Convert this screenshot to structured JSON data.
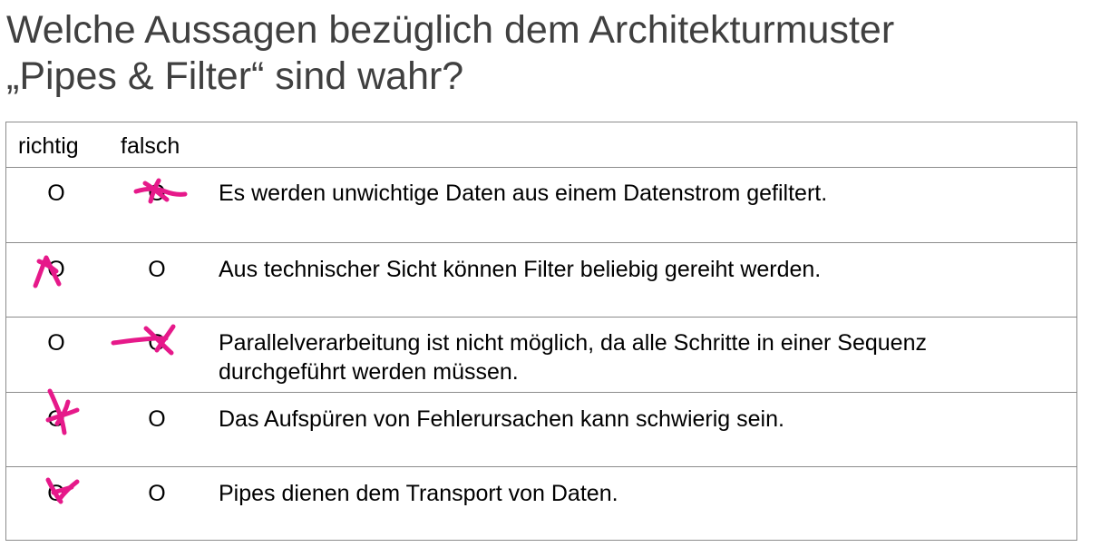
{
  "title": {
    "line1": "Welche Aussagen bezüglich dem Architekturmuster",
    "line2": "„Pipes & Filter“ sind wahr?"
  },
  "columns": {
    "richtig": "richtig",
    "falsch": "falsch"
  },
  "questions": [
    {
      "richtig_symbol": "O",
      "falsch_symbol": "O",
      "line1": "Es werden unwichtige Daten aus einem Datenstrom gefiltert.",
      "line2": "",
      "handwritten_mark": "falsch"
    },
    {
      "richtig_symbol": "O",
      "falsch_symbol": "O",
      "line1": "Aus technischer Sicht können Filter beliebig gereiht werden.",
      "line2": "",
      "handwritten_mark": "richtig"
    },
    {
      "richtig_symbol": "O",
      "falsch_symbol": "O",
      "line1": "Parallelverarbeitung ist nicht möglich, da alle Schritte in einer Sequenz",
      "line2": "durchgeführt werden müssen.",
      "handwritten_mark": "falsch"
    },
    {
      "richtig_symbol": "O",
      "falsch_symbol": "O",
      "line1": "Das Aufspüren von Fehlerursachen kann schwierig sein.",
      "line2": "",
      "handwritten_mark": "richtig"
    },
    {
      "richtig_symbol": "O",
      "falsch_symbol": "O",
      "line1": "Pipes dienen dem Transport von Daten.",
      "line2": "",
      "handwritten_mark": "richtig"
    }
  ],
  "colors": {
    "title": "#404040",
    "mark": "#e6198a",
    "border": "#8c8c8c"
  }
}
